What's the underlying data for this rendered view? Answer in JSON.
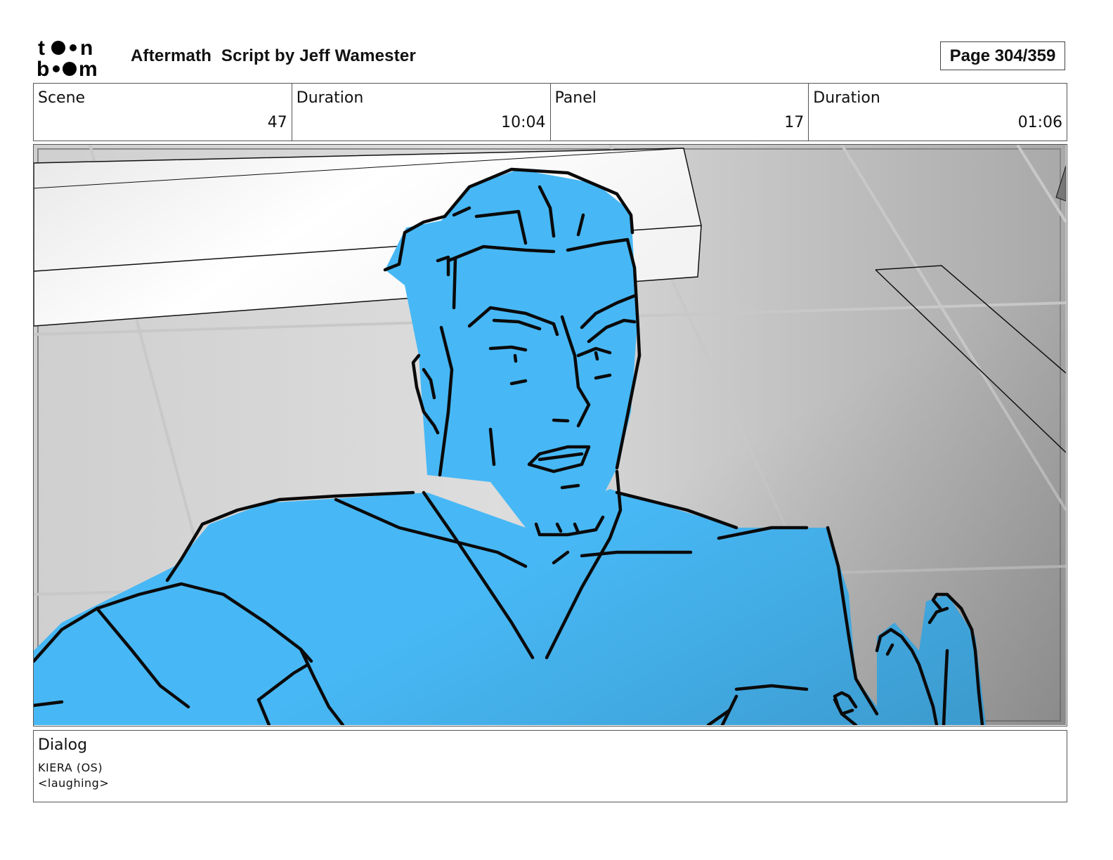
{
  "header": {
    "logo_text_top": "toon",
    "logo_text_bottom": "boom",
    "title": "Aftermath  Script by Jeff Wamester",
    "page": "Page 304/359"
  },
  "info": {
    "scene_label": "Scene",
    "scene_value": "47",
    "scene_duration_label": "Duration",
    "scene_duration_value": "10:04",
    "panel_label": "Panel",
    "panel_value": "17",
    "panel_duration_label": "Duration",
    "panel_duration_value": "01:06"
  },
  "panel": {
    "image": "storyboard-sketch-blue-man",
    "fill_color": "#47b8f5",
    "background_color": "#d4d4d4"
  },
  "dialog": {
    "title": "Dialog",
    "character": "KIERA (OS)",
    "line": "<laughing>"
  }
}
